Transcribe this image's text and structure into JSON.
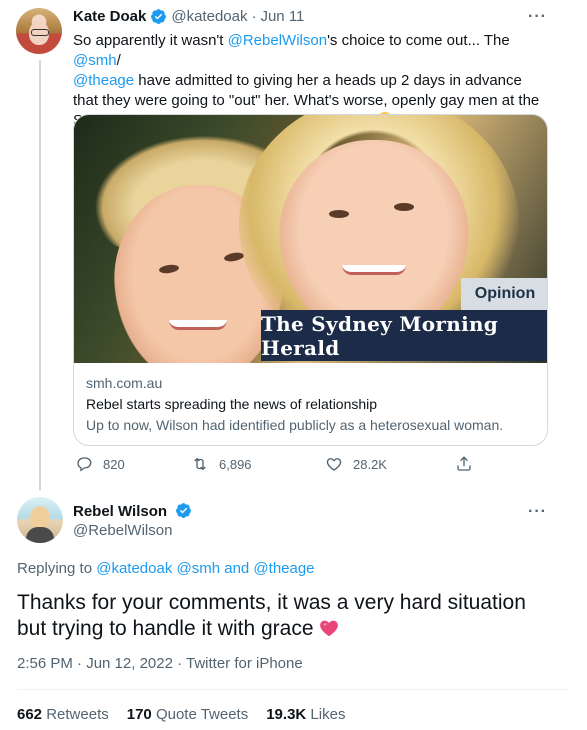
{
  "tweet": {
    "author_name": "Kate Doak",
    "author_handle": "@katedoak",
    "separator": "·",
    "date": "Jun 11",
    "text_parts": {
      "p1": "So apparently it wasn't ",
      "mention1": "@RebelWilson",
      "p2": "'s choice to come out... The ",
      "mention2": "@smh",
      "p3": "/",
      "mention3": "@theage",
      "p4": "  have admitted to giving her a heads up 2 days in advance that they were going to \"out\" her. What's worse, openly gay men at the Sydney Morning Herald were involved in this. "
    },
    "emoji": "woman-facepalming-emoji",
    "card": {
      "opinion_label": "Opinion",
      "masthead": "The Sydney Morning Herald",
      "domain": "smh.com.au",
      "title": "Rebel starts spreading the news of relationship",
      "description": "Up to now, Wilson had identified publicly as a heterosexual woman."
    },
    "actions": {
      "replies": "820",
      "retweets": "6,896",
      "likes": "28.2K"
    }
  },
  "reply": {
    "author_name": "Rebel Wilson",
    "author_handle": "@RebelWilson",
    "replying_prefix": "Replying to ",
    "replying_to": "@katedoak @smh and @theage",
    "text": "Thanks for your comments, it was a very hard situation but trying to handle it with grace ",
    "emoji": "heart-emoji",
    "timestamp": "2:56 PM · Jun 12, 2022 · Twitter for iPhone",
    "stats": {
      "retweets_count": "662",
      "retweets_label": "Retweets",
      "quotes_count": "170",
      "quotes_label": "Quote Tweets",
      "likes_count": "19.3K",
      "likes_label": "Likes"
    }
  },
  "colors": {
    "accent": "#1d9bf0",
    "muted": "#536471",
    "text": "#0f1419",
    "border": "#cfd9de"
  }
}
